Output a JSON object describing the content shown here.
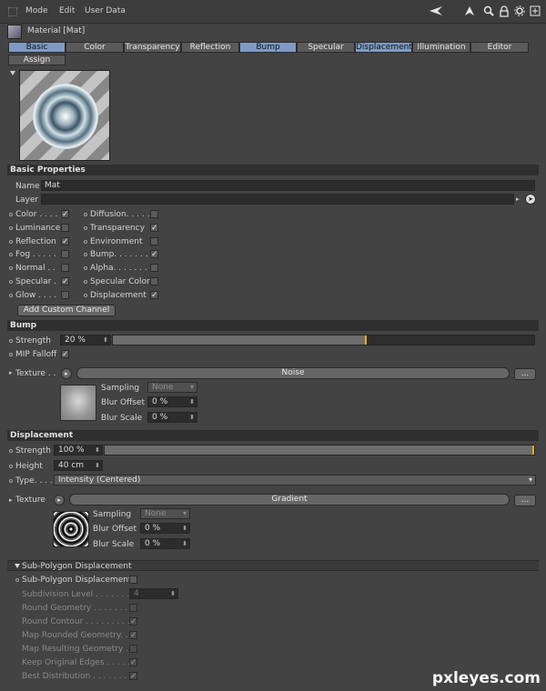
{
  "menu": {
    "mode": "Mode",
    "edit": "Edit",
    "user_data": "User Data"
  },
  "toolbar_icons": [
    "back-arrow-icon",
    "up-arrow-icon",
    "search-icon",
    "lock-icon",
    "settings-icon",
    "add-window-icon"
  ],
  "title": "Material [Mat]",
  "tabs": [
    {
      "label": "Basic",
      "active": true
    },
    {
      "label": "Color",
      "active": false
    },
    {
      "label": "Transparency",
      "active": false
    },
    {
      "label": "Reflection",
      "active": false
    },
    {
      "label": "Bump",
      "active": true
    },
    {
      "label": "Specular",
      "active": false
    },
    {
      "label": "Displacement",
      "active": true
    },
    {
      "label": "Illumination",
      "active": false
    },
    {
      "label": "Editor",
      "active": false
    },
    {
      "label": "Assign",
      "active": false
    }
  ],
  "basic": {
    "section": "Basic Properties",
    "name_label": "Name",
    "name_value": "Mat",
    "layer_label": "Layer",
    "channels_left": [
      {
        "label": "Color . . . .",
        "checked": true
      },
      {
        "label": "Luminance",
        "checked": false
      },
      {
        "label": "Reflection",
        "checked": true
      },
      {
        "label": "Fog . . . . .",
        "checked": false
      },
      {
        "label": "Normal . .",
        "checked": false
      },
      {
        "label": "Specular .",
        "checked": true
      },
      {
        "label": "Glow . . . .",
        "checked": false
      }
    ],
    "channels_right": [
      {
        "label": "Diffusion. . . . .",
        "checked": false
      },
      {
        "label": "Transparency",
        "checked": true
      },
      {
        "label": "Environment",
        "checked": false
      },
      {
        "label": "Bump. . . . . . . .",
        "checked": true
      },
      {
        "label": "Alpha. . . . . . . .",
        "checked": false
      },
      {
        "label": "Specular Color",
        "checked": false
      },
      {
        "label": "Displacement",
        "checked": true
      }
    ],
    "add_channel": "Add Custom Channel"
  },
  "bump": {
    "section": "Bump",
    "strength_label": "Strength",
    "strength_value": "20 %",
    "strength_fraction": 0.6,
    "mip_label": "MIP Falloff",
    "mip_checked": true,
    "texture_label": "Texture . .",
    "texture_name": "Noise",
    "more_button": "...",
    "sampling_label": "Sampling",
    "sampling_value": "None",
    "blur_offset_label": "Blur Offset",
    "blur_offset_value": "0 %",
    "blur_scale_label": "Blur Scale",
    "blur_scale_value": "0 %"
  },
  "displacement": {
    "section": "Displacement",
    "strength_label": "Strength",
    "strength_value": "100 %",
    "strength_fraction": 1.0,
    "height_label": "Height",
    "height_value": "40 cm",
    "type_label": "Type. . . .",
    "type_value": "Intensity (Centered)",
    "texture_label": "Texture",
    "texture_name": "Gradient",
    "more_button": "...",
    "sampling_label": "Sampling",
    "sampling_value": "None",
    "blur_offset_label": "Blur Offset",
    "blur_offset_value": "0 %",
    "blur_scale_label": "Blur Scale",
    "blur_scale_value": "0 %"
  },
  "subpoly": {
    "section": "Sub-Polygon Displacement",
    "toggle_label": "Sub-Polygon Displacement",
    "toggle_checked": false,
    "subdivision_label": "Subdivision Level . . . . . . . .",
    "subdivision_value": "4",
    "options": [
      {
        "label": "Round Geometry . . . . . . . .",
        "checked": false
      },
      {
        "label": "Round Contour . . . . . . . . .",
        "checked": true
      },
      {
        "label": "Map Rounded Geometry. . .",
        "checked": true
      },
      {
        "label": "Map Resulting Geometry . .",
        "checked": false
      },
      {
        "label": "Keep Original Edges . . . . .",
        "checked": true
      },
      {
        "label": "Best Distribution . . . . . . . .",
        "checked": true
      }
    ]
  },
  "watermark": "pxleyes.com"
}
